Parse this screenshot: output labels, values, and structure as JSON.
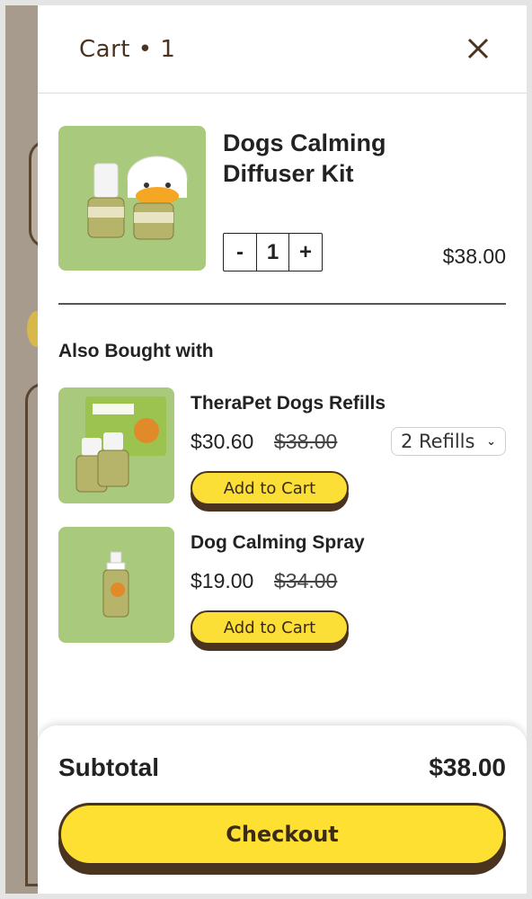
{
  "cart": {
    "title": "Cart • 1",
    "close_icon": "close-icon"
  },
  "item": {
    "name": "Dogs Calming Diffuser Kit",
    "quantity": "1",
    "minus_label": "-",
    "plus_label": "+",
    "price": "$38.00",
    "image_icon": "diffuser-product-image"
  },
  "also": {
    "title": "Also Bought with",
    "products": [
      {
        "name": "TheraPet Dogs Refills",
        "price": "$30.60",
        "old_price": "$38.00",
        "option": "2 Refills",
        "button": "Add to Cart",
        "image_icon": "refills-product-image"
      },
      {
        "name": "Dog Calming Spray",
        "price": "$19.00",
        "old_price": "$34.00",
        "button": "Add to Cart",
        "image_icon": "spray-product-image"
      }
    ]
  },
  "footer": {
    "subtotal_label": "Subtotal",
    "subtotal_value": "$38.00",
    "checkout_label": "Checkout"
  },
  "colors": {
    "accent_yellow": "#fbdf36",
    "brand_brown": "#4a3420",
    "product_bg_green": "#a9c97d"
  }
}
